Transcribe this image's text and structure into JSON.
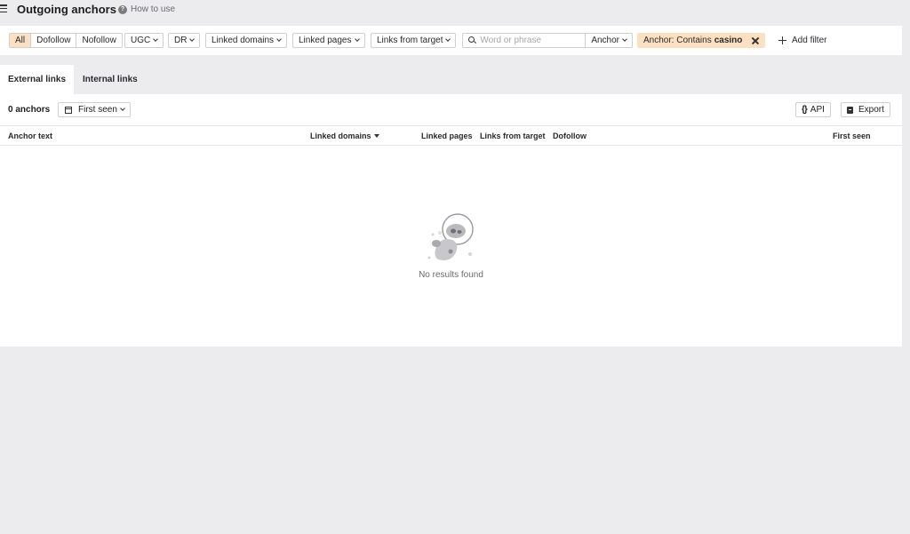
{
  "header": {
    "title": "Outgoing anchors",
    "how_to_use": "How to use"
  },
  "filters": {
    "segments": [
      {
        "label": "All",
        "active": true
      },
      {
        "label": "Dofollow",
        "active": false
      },
      {
        "label": "Nofollow",
        "active": false
      }
    ],
    "ugc": "UGC",
    "dr": "DR",
    "linked_domains": "Linked domains",
    "linked_pages": "Linked pages",
    "links_from_target": "Links from target",
    "search_placeholder": "Word or phrase",
    "search_value": "",
    "search_scope": "Anchor",
    "active_filter_prefix": "Anchor: Contains",
    "active_filter_value": "casino",
    "add_filter": "Add filter"
  },
  "tabs": [
    {
      "label": "External links",
      "active": true
    },
    {
      "label": "Internal links",
      "active": false
    }
  ],
  "results": {
    "count_label": "0 anchors",
    "first_seen_dd": "First seen",
    "api_label": "API",
    "export_label": "Export"
  },
  "table": {
    "columns": [
      "Anchor text",
      "Linked domains",
      "Linked pages",
      "Links from target",
      "Dofollow",
      "First seen"
    ],
    "sorted_column": "Linked domains",
    "rows": []
  },
  "empty_state": {
    "message": "No results found"
  },
  "colors": {
    "accent_fill": "#fbe0c2",
    "page_bg": "#ececee",
    "panel_bg": "#ffffff"
  }
}
